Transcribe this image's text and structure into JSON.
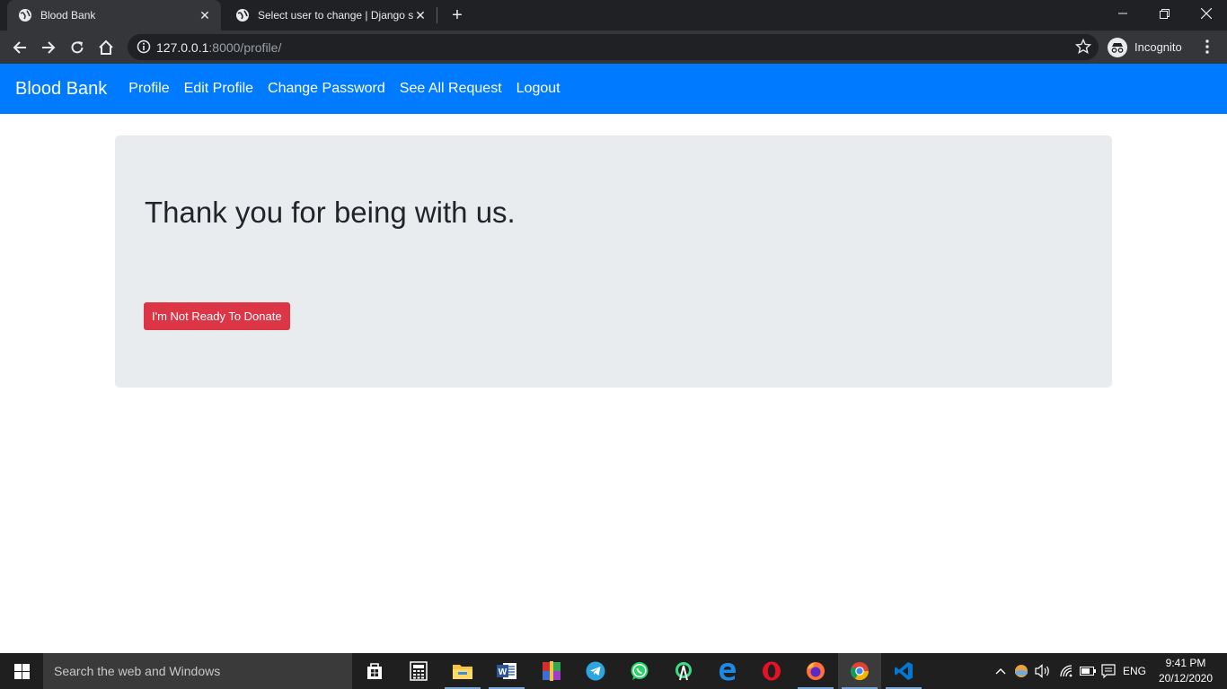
{
  "browser": {
    "tabs": [
      {
        "title": "Blood Bank",
        "active": true
      },
      {
        "title": "Select user to change | Django si",
        "active": false
      }
    ],
    "url_host": "127.0.0.1",
    "url_rest": ":8000/profile/",
    "profile_label": "Incognito"
  },
  "navbar": {
    "brand": "Blood Bank",
    "links": [
      "Profile",
      "Edit Profile",
      "Change Password",
      "See All Request",
      "Logout"
    ]
  },
  "main": {
    "heading": "Thank you for being with us.",
    "button_label": "I'm Not Ready To Donate"
  },
  "taskbar": {
    "search_placeholder": "Search the web and Windows",
    "language": "ENG",
    "time": "9:41 PM",
    "date": "20/12/2020",
    "apps": [
      "task-view",
      "calculator",
      "file-explorer",
      "word",
      "winrar",
      "telegram",
      "whatsapp",
      "android-studio",
      "edge",
      "opera",
      "firefox",
      "chrome",
      "vscode"
    ]
  },
  "colors": {
    "primary": "#007bff",
    "danger": "#dc3545",
    "jumbotron": "#e9ecef"
  }
}
